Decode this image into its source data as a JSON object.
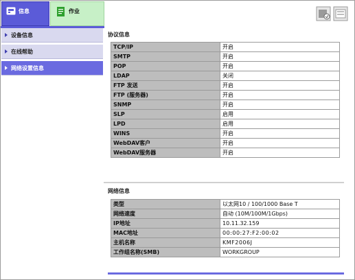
{
  "tabs": {
    "info_label": "信息",
    "job_label": "作业"
  },
  "sidebar": {
    "items": [
      {
        "label": "设备信息"
      },
      {
        "label": "在线帮助"
      },
      {
        "label": "网络设置信息"
      }
    ]
  },
  "protocol": {
    "title": "协议信息",
    "rows": [
      {
        "key": "TCP/IP",
        "value": "开启"
      },
      {
        "key": "SMTP",
        "value": "开启"
      },
      {
        "key": "POP",
        "value": "开启"
      },
      {
        "key": "LDAP",
        "value": "关闭"
      },
      {
        "key": "FTP 发送",
        "value": "开启"
      },
      {
        "key": "FTP (服务器)",
        "value": "开启"
      },
      {
        "key": "SNMP",
        "value": "开启"
      },
      {
        "key": "SLP",
        "value": "启用"
      },
      {
        "key": "LPD",
        "value": "启用"
      },
      {
        "key": "WINS",
        "value": "开启"
      },
      {
        "key": "WebDAV客户",
        "value": "开启"
      },
      {
        "key": "WebDAV服务器",
        "value": "开启"
      }
    ]
  },
  "network": {
    "title": "网络信息",
    "rows": [
      {
        "key": "类型",
        "value": "以太网10 / 100/1000 Base T"
      },
      {
        "key": "网络速度",
        "value": "自动 (10M/100M/1Gbps)"
      },
      {
        "key": "IP地址",
        "value": "10.11.32.159"
      },
      {
        "key": "MAC地址",
        "value": "00:00:27:F2:00:02"
      },
      {
        "key": "主机名称",
        "value": "KMF2006J"
      },
      {
        "key": "工作组名称(SMB)",
        "value": "WORKGROUP"
      }
    ]
  },
  "colors": {
    "accent": "#5b5bd8",
    "job_tab": "#c7f0c7",
    "table_key_bg": "#bdbdbd"
  }
}
